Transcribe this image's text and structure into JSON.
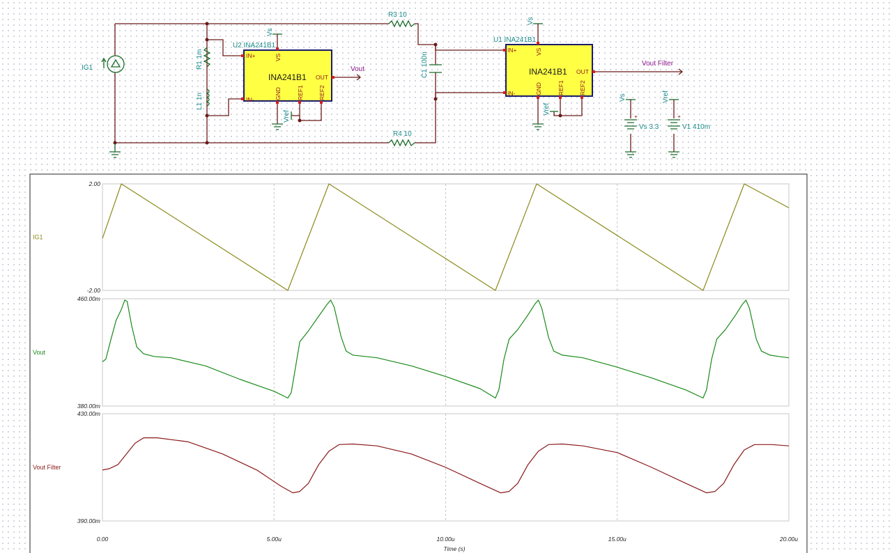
{
  "schematic": {
    "current_source": {
      "label": "IG1"
    },
    "resistors": [
      {
        "id": "r1",
        "label": "R1 1m"
      },
      {
        "id": "r3",
        "label": "R3 10"
      },
      {
        "id": "r4",
        "label": "R4 10"
      }
    ],
    "inductor": {
      "label": "L1 1n"
    },
    "capacitor": {
      "label": "C1 100n"
    },
    "amplifiers": [
      {
        "id": "u2",
        "ref": "U2 INA241B1",
        "name": "INA241B1",
        "pins": {
          "inp": "IN+",
          "inn": "IN-",
          "vs": "VS",
          "out": "OUT",
          "gnd": "GND",
          "ref1": "REF1",
          "ref2": "REF2"
        },
        "vs_label": "Vs",
        "vref_label": "Vref"
      },
      {
        "id": "u1",
        "ref": "U1 INA241B1",
        "name": "INA241B1",
        "pins": {
          "inp": "IN+",
          "inn": "IN-",
          "vs": "VS",
          "out": "OUT",
          "gnd": "GND",
          "ref1": "REF1",
          "ref2": "REF2"
        },
        "vs_label": "Vs",
        "vref_label": "Vref"
      }
    ],
    "outputs": {
      "vout": "Vout",
      "vout_filter": "Vout Filter"
    },
    "supplies": [
      {
        "id": "vs",
        "net": "Vs",
        "label": "Vs 3.3",
        "plus": "+"
      },
      {
        "id": "v1",
        "net": "Vref",
        "label": "V1 410m",
        "plus": "+"
      }
    ]
  },
  "chart_data": {
    "type": "line",
    "xlabel": "Time (s)",
    "x_ticks": [
      "0.00",
      "5.00u",
      "10.00u",
      "15.00u",
      "20.00u"
    ],
    "xlim_us": [
      0,
      20
    ],
    "colors": {
      "IG1": "#8a8a1a",
      "Vout": "#1a8a1a",
      "Vout Filter": "#8a1a1a"
    },
    "series": [
      {
        "name": "IG1",
        "ylim": [
          -2,
          2
        ],
        "y_ticks": [
          "2.00",
          "-2.00"
        ],
        "points": [
          [
            0,
            -0.05
          ],
          [
            0.55,
            2.0
          ],
          [
            5.4,
            -2.0
          ],
          [
            6.6,
            2.0
          ],
          [
            11.45,
            -2.0
          ],
          [
            12.65,
            2.0
          ],
          [
            17.5,
            -2.0
          ],
          [
            18.7,
            2.0
          ],
          [
            20,
            1.1
          ]
        ]
      },
      {
        "name": "Vout",
        "ylim": [
          380,
          460
        ],
        "y_ticks": [
          "460.00m",
          "380.00m"
        ],
        "points": [
          [
            0,
            413
          ],
          [
            0.1,
            415
          ],
          [
            0.25,
            430
          ],
          [
            0.4,
            444
          ],
          [
            0.55,
            452
          ],
          [
            0.65,
            459
          ],
          [
            0.72,
            458
          ],
          [
            0.85,
            440
          ],
          [
            1.0,
            424
          ],
          [
            1.2,
            419
          ],
          [
            1.5,
            417
          ],
          [
            2,
            416
          ],
          [
            3,
            410
          ],
          [
            4,
            400
          ],
          [
            5,
            391
          ],
          [
            5.4,
            386
          ],
          [
            5.5,
            390
          ],
          [
            5.6,
            405
          ],
          [
            5.75,
            428
          ],
          [
            6.0,
            436
          ],
          [
            6.3,
            447
          ],
          [
            6.55,
            456
          ],
          [
            6.65,
            459
          ],
          [
            6.75,
            454
          ],
          [
            6.95,
            432
          ],
          [
            7.1,
            421
          ],
          [
            7.3,
            418
          ],
          [
            8,
            416
          ],
          [
            9,
            410
          ],
          [
            10,
            402
          ],
          [
            11,
            393
          ],
          [
            11.45,
            386
          ],
          [
            11.55,
            392
          ],
          [
            11.7,
            415
          ],
          [
            11.85,
            430
          ],
          [
            12.1,
            437
          ],
          [
            12.4,
            448
          ],
          [
            12.6,
            456
          ],
          [
            12.7,
            459
          ],
          [
            12.8,
            453
          ],
          [
            13,
            431
          ],
          [
            13.15,
            421
          ],
          [
            13.4,
            418
          ],
          [
            14,
            416
          ],
          [
            15,
            409
          ],
          [
            16,
            401
          ],
          [
            17,
            392
          ],
          [
            17.5,
            386
          ],
          [
            17.6,
            392
          ],
          [
            17.75,
            415
          ],
          [
            17.9,
            430
          ],
          [
            18.15,
            437
          ],
          [
            18.45,
            448
          ],
          [
            18.65,
            456
          ],
          [
            18.75,
            459
          ],
          [
            18.85,
            453
          ],
          [
            19.05,
            430
          ],
          [
            19.2,
            421
          ],
          [
            19.45,
            418
          ],
          [
            19.7,
            417
          ],
          [
            20,
            416
          ]
        ]
      },
      {
        "name": "Vout Filter",
        "ylim": [
          390,
          430
        ],
        "y_ticks": [
          "430.00m",
          "390.00m"
        ],
        "points": [
          [
            0,
            409
          ],
          [
            0.2,
            409.5
          ],
          [
            0.45,
            411
          ],
          [
            0.7,
            415
          ],
          [
            0.95,
            419
          ],
          [
            1.2,
            421
          ],
          [
            1.6,
            421
          ],
          [
            2.5,
            419.5
          ],
          [
            3.5,
            415
          ],
          [
            4.5,
            409
          ],
          [
            5.2,
            403
          ],
          [
            5.55,
            400.5
          ],
          [
            5.75,
            401
          ],
          [
            6.0,
            404
          ],
          [
            6.3,
            411
          ],
          [
            6.6,
            416
          ],
          [
            6.9,
            418.5
          ],
          [
            7.3,
            418.7
          ],
          [
            8,
            418
          ],
          [
            9,
            415
          ],
          [
            10,
            410
          ],
          [
            11,
            404
          ],
          [
            11.6,
            400.5
          ],
          [
            11.85,
            401
          ],
          [
            12.1,
            404
          ],
          [
            12.4,
            411
          ],
          [
            12.7,
            416
          ],
          [
            13,
            418.5
          ],
          [
            13.4,
            418.7
          ],
          [
            14,
            418
          ],
          [
            15,
            415.5
          ],
          [
            16,
            410
          ],
          [
            17,
            404
          ],
          [
            17.6,
            400.5
          ],
          [
            17.85,
            401
          ],
          [
            18.1,
            404
          ],
          [
            18.4,
            411
          ],
          [
            18.7,
            416.5
          ],
          [
            19,
            418.5
          ],
          [
            19.5,
            418.5
          ],
          [
            20,
            418
          ]
        ]
      }
    ]
  }
}
